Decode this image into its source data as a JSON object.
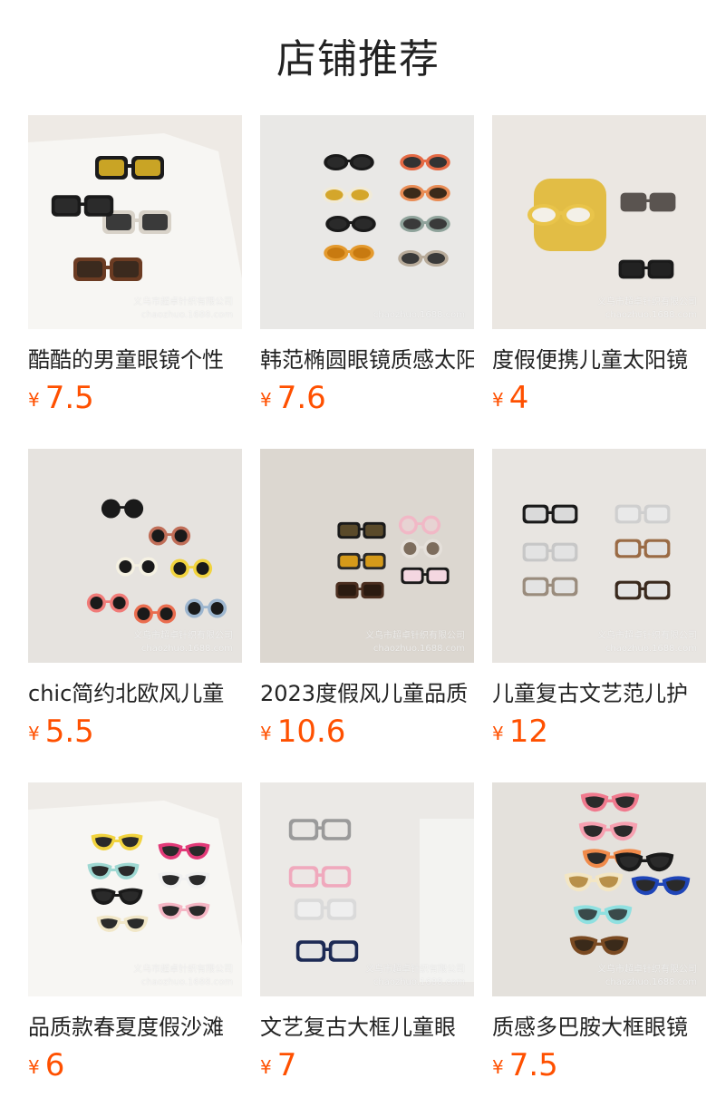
{
  "section": {
    "title": "店铺推荐"
  },
  "currency_symbol": "¥",
  "products": [
    {
      "name": "酷酷的男童眼镜个性",
      "price": "7.5",
      "watermark_line1": "义乌市超卓针织有限公司",
      "watermark_line2": "chaozhuo.1688.com",
      "bg": "#eeeae5"
    },
    {
      "name": "韩范椭圆眼镜质感太阳",
      "price": "7.6",
      "watermark_line1": "",
      "watermark_line2": "chaozhuo.1688.com",
      "bg": "#e9e8e6"
    },
    {
      "name": "度假便携儿童太阳镜",
      "price": "4",
      "watermark_line1": "义乌市超卓针织有限公司",
      "watermark_line2": "chaozhuo.1688.com",
      "bg": "#ebe7e2"
    },
    {
      "name": "chic简约北欧风儿童",
      "price": "5.5",
      "watermark_line1": "义乌市超卓针织有限公司",
      "watermark_line2": "chaozhuo.1688.com",
      "bg": "#e6e3df"
    },
    {
      "name": "2023度假风儿童品质",
      "price": "10.6",
      "watermark_line1": "义乌市超卓针织有限公司",
      "watermark_line2": "chaozhuo.1688.com",
      "bg": "#dcd7d0"
    },
    {
      "name": "儿童复古文艺范儿护",
      "price": "12",
      "watermark_line1": "义乌市超卓针织有限公司",
      "watermark_line2": "chaozhuo.1688.com",
      "bg": "#e8e5e1"
    },
    {
      "name": "品质款春夏度假沙滩",
      "price": "6",
      "watermark_line1": "义乌市超卓针织有限公司",
      "watermark_line2": "chaozhuo.1688.com",
      "bg": "#eeebe7"
    },
    {
      "name": "文艺复古大框儿童眼",
      "price": "7",
      "watermark_line1": "义乌市超卓针织有限公司",
      "watermark_line2": "chaozhuo.1688.com",
      "bg": "#ebe9e6"
    },
    {
      "name": "质感多巴胺大框眼镜",
      "price": "7.5",
      "watermark_line1": "义乌市超卓针织有限公司",
      "watermark_line2": "chaozhuo.1688.com",
      "bg": "#e4e1dc"
    }
  ],
  "icons": {
    "thumbnail": "sunglasses-photo"
  }
}
